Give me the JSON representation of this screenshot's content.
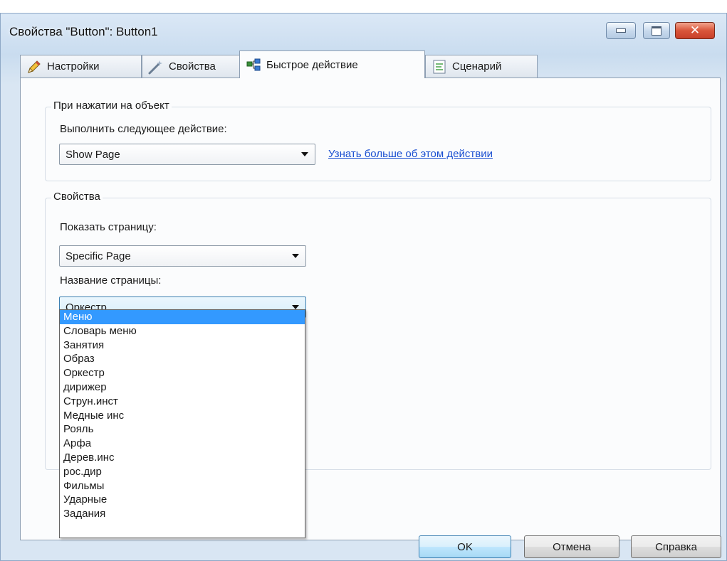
{
  "window": {
    "title": "Свойства \"Button\": Button1",
    "close_glyph": "✕"
  },
  "tabs": [
    {
      "label": "Настройки",
      "icon": "pencil-icon"
    },
    {
      "label": "Свойства",
      "icon": "wand-icon"
    },
    {
      "label": "Быстрое действие",
      "icon": "quick-action-icon",
      "active": true
    },
    {
      "label": "Сценарий",
      "icon": "script-icon"
    }
  ],
  "on_click_group": {
    "title": "При нажатии на объект",
    "action_label": "Выполнить следующее действие:",
    "action_value": "Show Page",
    "learn_more_link": "Узнать больше об этом действии"
  },
  "properties_group": {
    "title": "Свойства",
    "show_page_label": "Показать страницу:",
    "show_page_value": "Specific Page",
    "page_name_label": "Название страницы:",
    "page_name_value": "Оркестр"
  },
  "dropdown": {
    "items": [
      "Меню",
      "Словарь меню",
      "Занятия",
      "Образ",
      "Оркестр",
      "дирижер",
      "Струн.инст",
      "Медные инс",
      "Рояль",
      "Арфа",
      "Дерев.инс",
      "рос.дир",
      "Фильмы",
      "Ударные",
      "Задания"
    ],
    "highlighted": "Меню"
  },
  "buttons": {
    "ok": "OK",
    "cancel": "Отмена",
    "help": "Справка"
  },
  "colors": {
    "selection": "#3399ff",
    "link": "#1a4fd1"
  }
}
